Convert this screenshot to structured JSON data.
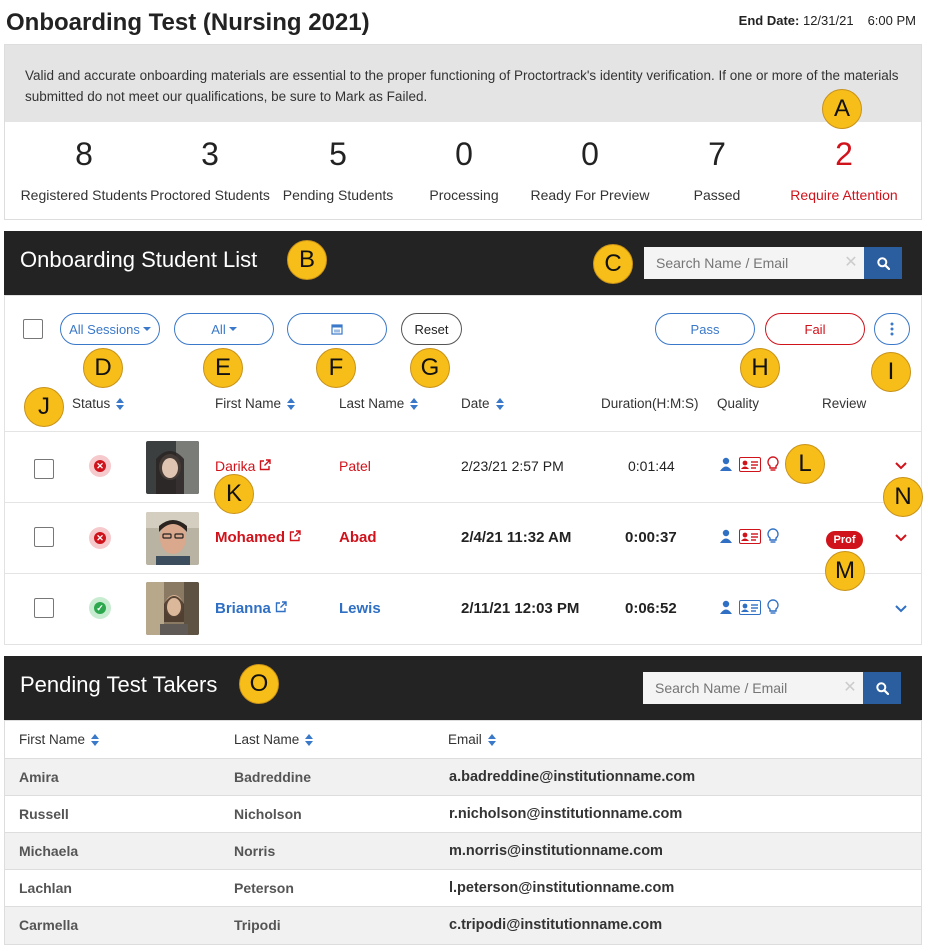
{
  "header": {
    "title": "Onboarding Test (Nursing 2021)",
    "end_date_label": "End Date:",
    "end_date": "12/31/21",
    "end_time": "6:00 PM"
  },
  "notice": "Valid and accurate onboarding materials are essential to the proper functioning of Proctortrack's identity verification. If one or more of the materials submitted do not meet our qualifications, be sure to Mark as Failed.",
  "stats": [
    {
      "value": "8",
      "label": "Registered Students"
    },
    {
      "value": "3",
      "label": "Proctored Students"
    },
    {
      "value": "5",
      "label": "Pending Students"
    },
    {
      "value": "0",
      "label": "Processing"
    },
    {
      "value": "0",
      "label": "Ready For Preview"
    },
    {
      "value": "7",
      "label": "Passed"
    },
    {
      "value": "2",
      "label": "Require Attention"
    }
  ],
  "student_list": {
    "title": "Onboarding Student List",
    "search_placeholder": "Search Name / Email",
    "filters": {
      "sessions": "All Sessions",
      "all": "All",
      "reset": "Reset",
      "pass": "Pass",
      "fail": "Fail"
    },
    "columns": {
      "status": "Status",
      "first_name": "First Name",
      "last_name": "Last Name",
      "date": "Date",
      "duration": "Duration(H:M:S)",
      "quality": "Quality",
      "review": "Review"
    },
    "rows": [
      {
        "first": "Darika",
        "last": "Patel",
        "date": "2/23/21 2:57 PM",
        "duration": "0:01:44",
        "status": "failed",
        "review": ""
      },
      {
        "first": "Mohamed",
        "last": "Abad",
        "date": "2/4/21 11:32 AM",
        "duration": "0:00:37",
        "status": "failed",
        "review": "Prof"
      },
      {
        "first": "Brianna",
        "last": "Lewis",
        "date": "2/11/21 12:03 PM",
        "duration": "0:06:52",
        "status": "passed",
        "review": ""
      }
    ]
  },
  "pending": {
    "title": "Pending Test Takers",
    "search_placeholder": "Search Name / Email",
    "columns": {
      "first_name": "First Name",
      "last_name": "Last Name",
      "email": "Email"
    },
    "rows": [
      {
        "first": "Amira",
        "last": "Badreddine",
        "email": "a.badreddine@institutionname.com"
      },
      {
        "first": "Russell",
        "last": "Nicholson",
        "email": "r.nicholson@institutionname.com"
      },
      {
        "first": "Michaela",
        "last": "Norris",
        "email": "m.norris@institutionname.com"
      },
      {
        "first": "Lachlan",
        "last": "Peterson",
        "email": "l.peterson@institutionname.com"
      },
      {
        "first": "Carmella",
        "last": "Tripodi",
        "email": "c.tripodi@institutionname.com"
      }
    ]
  },
  "markers": [
    "A",
    "B",
    "C",
    "D",
    "E",
    "F",
    "G",
    "H",
    "I",
    "J",
    "K",
    "L",
    "M",
    "N",
    "O"
  ],
  "icons": {
    "search": "magnifier-icon",
    "clear": "times-icon",
    "calendar": "calendar-icon",
    "more": "vertical-ellipsis-icon",
    "external": "external-link-icon",
    "user": "user-icon",
    "id_card": "id-card-icon",
    "bulb": "lightbulb-icon",
    "chevron": "chevron-down-icon"
  },
  "colors": {
    "accent_blue": "#3a78c9",
    "alert_red": "#d0121b",
    "pass_green": "#2ea84e",
    "dark_bar": "#232323",
    "marker_yellow": "#f7bd18"
  }
}
